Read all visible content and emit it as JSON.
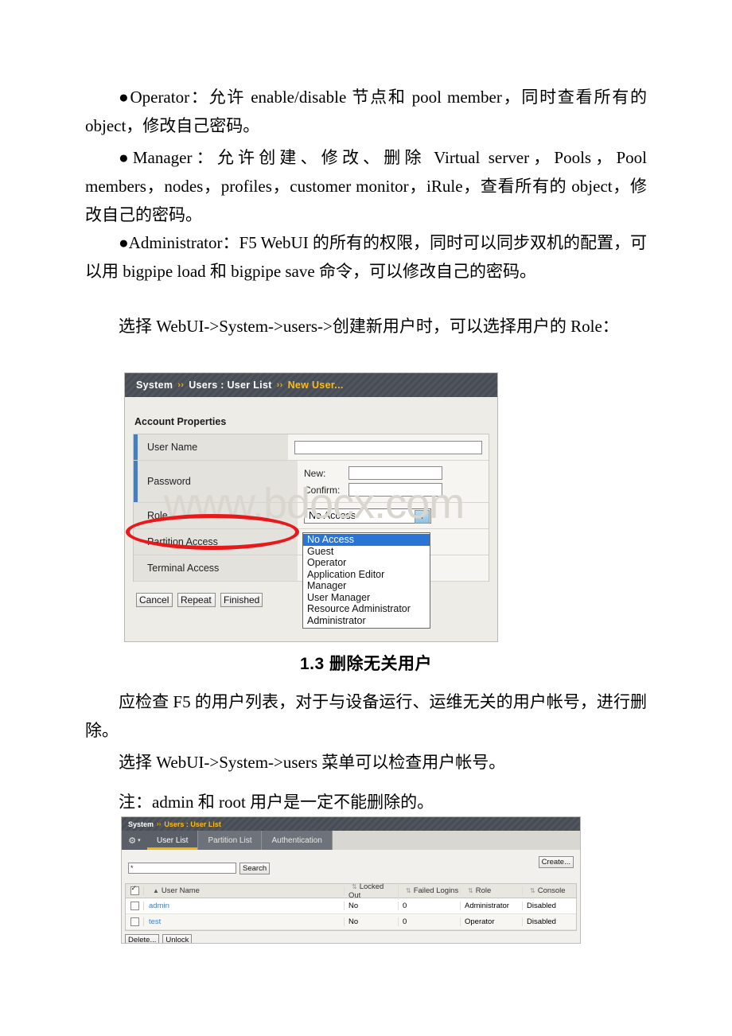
{
  "document": {
    "paragraphs": [
      "●Operator：允许 enable/disable 节点和 pool member，同时查看所有的 object，修改自己密码。",
      "●Manager：允许创建、修改、删除 Virtual server，Pools，Pool members，nodes，profiles，customer monitor，iRule，查看所有的 object，修改自己的密码。",
      "●Administrator：F5 WebUI 的所有的权限，同时可以同步双机的配置，可以用 bigpipe load 和 bigpipe save 命令，可以修改自己的密码。",
      "选择 WebUI->System->users->创建新用户时，可以选择用户的 Role："
    ],
    "heading": "1.3 删除无关用户",
    "paragraphs2": [
      "应检查 F5 的用户列表，对于与设备运行、运维无关的用户帐号，进行删除。",
      "选择 WebUI->System->users 菜单可以检查用户帐号。",
      "注：admin 和 root 用户是一定不能删除的。"
    ],
    "watermark": "www.bdocx.com"
  },
  "new_user_panel": {
    "breadcrumb": {
      "root": "System",
      "middle": "Users : User List",
      "current": "New User...",
      "separator": "››"
    },
    "section_title": "Account Properties",
    "rows": [
      {
        "label": "User Name",
        "value": ""
      },
      {
        "label": "Password",
        "new_label": "New:",
        "confirm_label": "Confirm:"
      },
      {
        "label": "Role",
        "value": "No Access"
      },
      {
        "label": "Partition Access",
        "value": ""
      },
      {
        "label": "Terminal Access",
        "value": ""
      }
    ],
    "role_dropdown": {
      "selected": "No Access",
      "options": [
        "No Access",
        "Guest",
        "Operator",
        "Application Editor",
        "Manager",
        "User Manager",
        "Resource Administrator",
        "Administrator"
      ]
    },
    "buttons": {
      "cancel": "Cancel",
      "repeat": "Repeat",
      "finished": "Finished"
    },
    "colors": {
      "header_bar": "#4b5058",
      "current_crumb": "#fdbb14",
      "required_marker": "#4a7ebb",
      "dropdown_selected": "#2a74d4",
      "annotation": "#e8191b"
    }
  },
  "user_list_panel": {
    "breadcrumb": {
      "root": "System",
      "current": "Users : User List",
      "separator": "››"
    },
    "gear_icon": "gear-icon",
    "tabs": [
      {
        "label": "User List",
        "active": true
      },
      {
        "label": "Partition List",
        "active": false
      },
      {
        "label": "Authentication",
        "active": false
      }
    ],
    "search": {
      "value": "*",
      "button": "Search"
    },
    "create_button": "Create...",
    "table": {
      "headers": [
        "User Name",
        "Locked Out",
        "Failed Logins",
        "Role",
        "Console"
      ],
      "rows": [
        {
          "name": "admin",
          "locked_out": "No",
          "failed_logins": "0",
          "role": "Administrator",
          "console": "Disabled"
        },
        {
          "name": "test",
          "locked_out": "No",
          "failed_logins": "0",
          "role": "Operator",
          "console": "Disabled"
        }
      ]
    },
    "footer_buttons": {
      "delete": "Delete...",
      "unlock": "Unlock"
    },
    "colors": {
      "header_bar": "#4b5058",
      "active_tab_underline": "#f2b705",
      "link": "#4a7ebb"
    }
  }
}
